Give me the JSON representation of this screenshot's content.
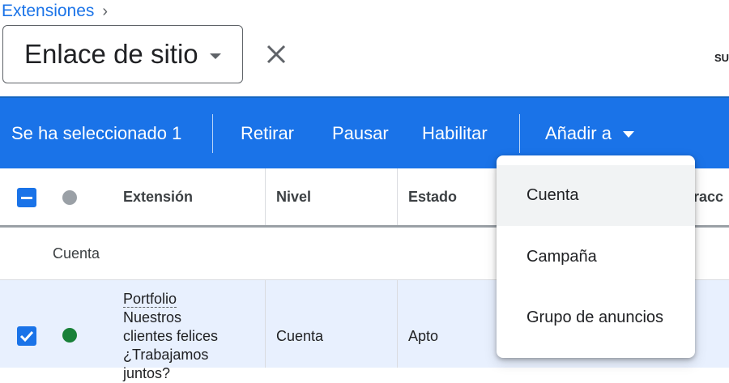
{
  "breadcrumb": {
    "parent": "Extensiones",
    "separator": "›"
  },
  "type_selector": {
    "value": "Enlace de sitio"
  },
  "edge_text": "SU",
  "action_bar": {
    "selected_label": "Se ha seleccionado 1",
    "remove": "Retirar",
    "pause": "Pausar",
    "enable": "Habilitar",
    "add_to": "Añadir a"
  },
  "table": {
    "headers": {
      "extension": "Extensión",
      "level": "Nivel",
      "status": "Estado",
      "partial": "eracc"
    },
    "group_label": "Cuenta",
    "row": {
      "extension_lines": [
        "Portfolio",
        "Nuestros",
        "clientes felices",
        "¿Trabajamos",
        "juntos?"
      ],
      "level": "Cuenta",
      "status": "Apto"
    }
  },
  "dropdown": {
    "items": [
      "Cuenta",
      "Campaña",
      "Grupo de anuncios"
    ]
  },
  "colors": {
    "accent": "#1a73e8",
    "status_green": "#188038",
    "status_grey": "#9aa0a6"
  }
}
